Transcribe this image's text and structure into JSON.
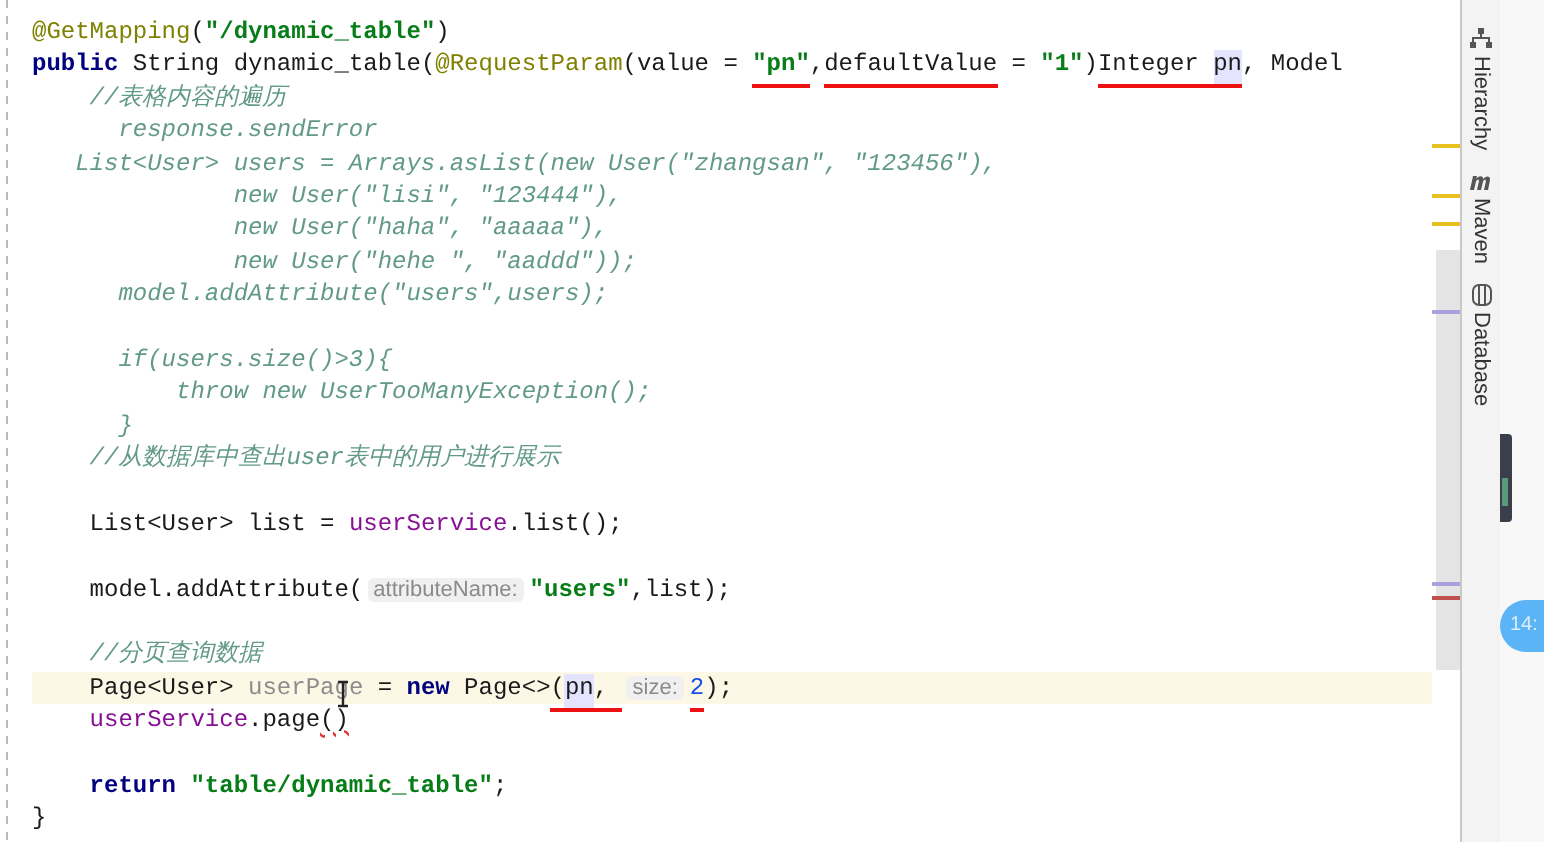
{
  "editor": {
    "lines": [
      {
        "current": false,
        "tokens": [
          {
            "text": "@GetMapping",
            "kind": "annotation",
            "marked": false
          },
          {
            "text": "(",
            "kind": "plain",
            "marked": false
          },
          {
            "text": "\"/dynamic_table\"",
            "kind": "string",
            "marked": false
          },
          {
            "text": ")",
            "kind": "plain",
            "marked": false
          }
        ]
      },
      {
        "current": false,
        "tokens": [
          {
            "text": "public",
            "kind": "keyword",
            "marked": false
          },
          {
            "text": " String dynamic_table(",
            "kind": "plain",
            "marked": false
          },
          {
            "text": "@RequestParam",
            "kind": "annotation",
            "marked": false
          },
          {
            "text": "(value = ",
            "kind": "plain",
            "marked": false
          },
          {
            "text": "\"pn\"",
            "kind": "string",
            "marked": true
          },
          {
            "text": ",",
            "kind": "plain",
            "marked": false
          },
          {
            "text": "defaultValue",
            "kind": "plain",
            "marked": true
          },
          {
            "text": " = ",
            "kind": "plain",
            "marked": false
          },
          {
            "text": "\"1\"",
            "kind": "string",
            "marked": false
          },
          {
            "text": ")",
            "kind": "plain",
            "marked": false
          },
          {
            "text": "Integer ",
            "kind": "plain",
            "marked": true
          },
          {
            "text": "pn",
            "kind": "reference",
            "marked": true
          },
          {
            "text": ", Model",
            "kind": "plain",
            "marked": false
          }
        ]
      },
      {
        "current": false,
        "tokens": [
          {
            "text": "    //表格内容的遍历",
            "kind": "comment",
            "marked": false
          }
        ]
      },
      {
        "current": false,
        "tokens": [
          {
            "text": "      response.sendError",
            "kind": "comment",
            "marked": false
          }
        ]
      },
      {
        "current": false,
        "tokens": [
          {
            "text": "   List<User> users = Arrays.asList(new User(\"zhangsan\", \"123456\"),",
            "kind": "comment",
            "marked": false
          }
        ]
      },
      {
        "current": false,
        "tokens": [
          {
            "text": "              new User(\"lisi\", \"123444\"),",
            "kind": "comment",
            "marked": false
          }
        ]
      },
      {
        "current": false,
        "tokens": [
          {
            "text": "              new User(\"haha\", \"aaaaa\"),",
            "kind": "comment",
            "marked": false
          }
        ]
      },
      {
        "current": false,
        "tokens": [
          {
            "text": "              new User(\"hehe \", \"aaddd\"));",
            "kind": "comment",
            "marked": false
          }
        ]
      },
      {
        "current": false,
        "tokens": [
          {
            "text": "      model.addAttribute(\"users\",users);",
            "kind": "comment",
            "marked": false
          }
        ]
      },
      {
        "current": false
      },
      {
        "current": false,
        "tokens": [
          {
            "text": "      if(users.size()>3){",
            "kind": "comment",
            "marked": false
          }
        ]
      },
      {
        "current": false,
        "tokens": [
          {
            "text": "          throw new UserTooManyException();",
            "kind": "comment",
            "marked": false
          }
        ]
      },
      {
        "current": false,
        "tokens": [
          {
            "text": "      }",
            "kind": "comment",
            "marked": false
          }
        ]
      },
      {
        "current": false,
        "tokens": [
          {
            "text": "    //从数据库中查出user表中的用户进行展示",
            "kind": "comment",
            "marked": false
          }
        ]
      },
      {
        "current": false
      },
      {
        "current": false,
        "tokens": [
          {
            "text": "    List<User> list = ",
            "kind": "plain",
            "marked": false
          },
          {
            "text": "userService",
            "kind": "field",
            "marked": false
          },
          {
            "text": ".list();",
            "kind": "plain",
            "marked": false
          }
        ]
      },
      {
        "current": false
      },
      {
        "current": false,
        "tokens": [
          {
            "text": "    model.addAttribute(",
            "kind": "plain",
            "marked": false
          },
          {
            "text": "attributeName:",
            "kind": "hint",
            "marked": false
          },
          {
            "text": "\"users\"",
            "kind": "string",
            "marked": false
          },
          {
            "text": ",list);",
            "kind": "plain",
            "marked": false
          }
        ]
      },
      {
        "current": false
      },
      {
        "current": false,
        "tokens": [
          {
            "text": "    //分页查询数据",
            "kind": "comment",
            "marked": false
          }
        ]
      },
      {
        "current": true,
        "tokens": [
          {
            "text": "    Page<User> ",
            "kind": "plain",
            "marked": false
          },
          {
            "text": "userPage",
            "kind": "unused",
            "marked": false
          },
          {
            "text": " = ",
            "kind": "plain",
            "marked": false
          },
          {
            "text": "new",
            "kind": "keyword",
            "marked": false
          },
          {
            "text": " Page<>",
            "kind": "plain",
            "marked": false
          },
          {
            "text": "(",
            "kind": "plain",
            "marked": true
          },
          {
            "text": "pn",
            "kind": "reference",
            "marked": true
          },
          {
            "text": ", ",
            "kind": "plain",
            "marked": true
          },
          {
            "text": "size:",
            "kind": "hint",
            "marked": false
          },
          {
            "text": "2",
            "kind": "number",
            "marked": true
          },
          {
            "text": ");",
            "kind": "plain",
            "marked": false
          }
        ]
      },
      {
        "current": false,
        "tokens": [
          {
            "text": "    userService",
            "kind": "field",
            "marked": false
          },
          {
            "text": ".page",
            "kind": "plain",
            "marked": false
          },
          {
            "text": "()",
            "kind": "error",
            "marked": false
          }
        ]
      },
      {
        "current": false
      },
      {
        "current": false,
        "tokens": [
          {
            "text": "    return",
            "kind": "keyword",
            "marked": false
          },
          {
            "text": " \"table/dynamic_table\"",
            "kind": "string",
            "marked": false
          },
          {
            "text": ";",
            "kind": "plain",
            "marked": false
          }
        ]
      },
      {
        "current": false,
        "tokens": [
          {
            "text": "}",
            "kind": "plain",
            "marked": false
          }
        ]
      }
    ]
  },
  "tool_windows": [
    {
      "label": "Hierarchy",
      "kind": "hierarchy"
    },
    {
      "label": "Maven",
      "kind": "maven"
    },
    {
      "label": "Database",
      "kind": "database"
    }
  ],
  "badge": {
    "text": "14:"
  }
}
